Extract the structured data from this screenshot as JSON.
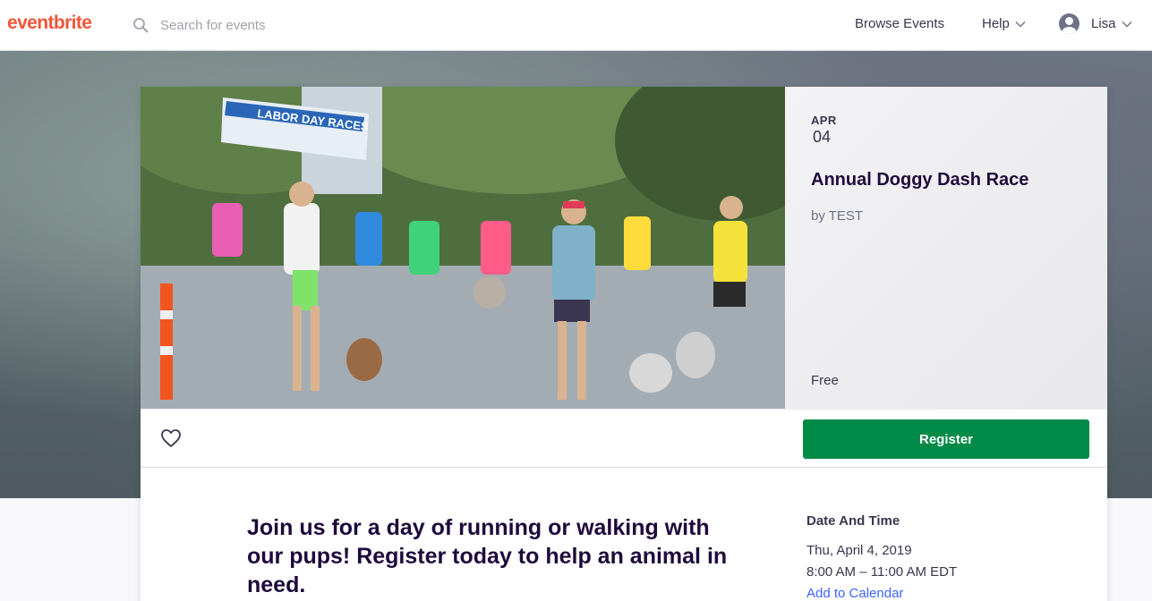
{
  "brand": {
    "logo_text": "eventbrite",
    "accent": "#f05537"
  },
  "header": {
    "search_placeholder": "Search for events",
    "browse_label": "Browse Events",
    "help_label": "Help",
    "user_name": "Lisa"
  },
  "event": {
    "month": "APR",
    "day": "04",
    "title": "Annual Doggy Dash Race",
    "organizer": "by TEST",
    "price": "Free",
    "register_label": "Register",
    "register_color": "#008a47",
    "banner_text": "LABOR DAY RACES",
    "summary": "Join us for a day of running or walking with our pups! Register today to help an animal in need."
  },
  "date_time": {
    "heading": "Date And Time",
    "date": "Thu, April 4, 2019",
    "time": "8:00 AM – 11:00 AM EDT",
    "add_to_calendar": "Add to Calendar"
  },
  "icons": {
    "search": "search-icon",
    "chevron": "chevron-down-icon",
    "avatar": "user-avatar-icon",
    "like": "heart-icon"
  }
}
